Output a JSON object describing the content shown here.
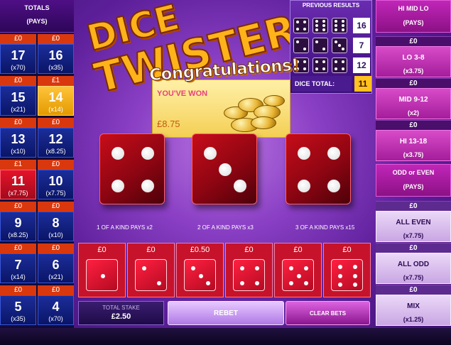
{
  "left": {
    "header1": "TOTALS",
    "header2": "(PAYS)",
    "rows": [
      {
        "cells": [
          {
            "stake": "£0",
            "num": "17",
            "pays": "(x70)"
          },
          {
            "stake": "£0",
            "num": "16",
            "pays": "(x35)"
          }
        ]
      },
      {
        "cells": [
          {
            "stake": "£0",
            "num": "15",
            "pays": "(x21)"
          },
          {
            "stake": "£1",
            "num": "14",
            "pays": "(x14)"
          }
        ]
      },
      {
        "cells": [
          {
            "stake": "£0",
            "num": "13",
            "pays": "(x10)"
          },
          {
            "stake": "£0",
            "num": "12",
            "pays": "(x8.25)"
          }
        ]
      },
      {
        "cells": [
          {
            "stake": "£1",
            "num": "11",
            "pays": "(x7.75)"
          },
          {
            "stake": "£0",
            "num": "10",
            "pays": "(x7.75)"
          }
        ]
      },
      {
        "cells": [
          {
            "stake": "£0",
            "num": "9",
            "pays": "(x8.25)"
          },
          {
            "stake": "£0",
            "num": "8",
            "pays": "(x10)"
          }
        ]
      },
      {
        "cells": [
          {
            "stake": "£0",
            "num": "7",
            "pays": "(x14)"
          },
          {
            "stake": "£0",
            "num": "6",
            "pays": "(x21)"
          }
        ]
      },
      {
        "cells": [
          {
            "stake": "£0",
            "num": "5",
            "pays": "(x35)"
          },
          {
            "stake": "£0",
            "num": "4",
            "pays": "(x70)"
          }
        ]
      }
    ]
  },
  "right": {
    "himidlo_header1": "HI MID LO",
    "himidlo_header2": "(PAYS)",
    "himidlo": [
      {
        "stake": "£0",
        "label": "LO 3-8",
        "pays": "(x3.75)"
      },
      {
        "stake": "£0",
        "label": "MID 9-12",
        "pays": "(x2)"
      },
      {
        "stake": "£0",
        "label": "HI 13-18",
        "pays": "(x3.75)"
      }
    ],
    "oddeven_header1": "ODD or EVEN",
    "oddeven_header2": "(PAYS)",
    "oddeven": [
      {
        "stake": "£0",
        "label": "ALL EVEN",
        "pays": "(x7.75)"
      },
      {
        "stake": "£0",
        "label": "ALL ODD",
        "pays": "(x7.75)"
      },
      {
        "stake": "£0",
        "label": "MIX",
        "pays": "(x1.25)"
      }
    ]
  },
  "logo": {
    "line1": "DICE",
    "line2": "TWISTER"
  },
  "previous_results": {
    "title": "PREVIOUS RESULTS",
    "rows": [
      {
        "dice": [
          4,
          6,
          6
        ],
        "total": "16"
      },
      {
        "dice": [
          2,
          2,
          3
        ],
        "total": "7"
      },
      {
        "dice": [
          4,
          4,
          4
        ],
        "total": "12"
      }
    ],
    "dice_total_label": "DICE TOTAL:",
    "dice_total_value": "11"
  },
  "win": {
    "congrats": "Congratulations!",
    "you_won": "YOU'VE WON",
    "amount": "£8.75"
  },
  "main_dice": [
    4,
    3,
    4
  ],
  "pays_labels": [
    "1 OF A KIND PAYS x2",
    "2 OF A KIND PAYS x3",
    "3 OF A KIND PAYS x15"
  ],
  "single_bets": [
    {
      "stake": "£0",
      "face": 1
    },
    {
      "stake": "£0",
      "face": 2
    },
    {
      "stake": "£0.50",
      "face": 3
    },
    {
      "stake": "£0",
      "face": 4
    },
    {
      "stake": "£0",
      "face": 5
    },
    {
      "stake": "£0",
      "face": 6
    }
  ],
  "bottom": {
    "total_stake_label": "TOTAL STAKE",
    "total_stake_value": "£2.50",
    "rebet": "REBET",
    "clear": "CLEAR BETS"
  },
  "colors": {
    "accent": "#ffc21e",
    "bet_red": "#c6122a",
    "brand_purple": "#5d1f9a"
  }
}
